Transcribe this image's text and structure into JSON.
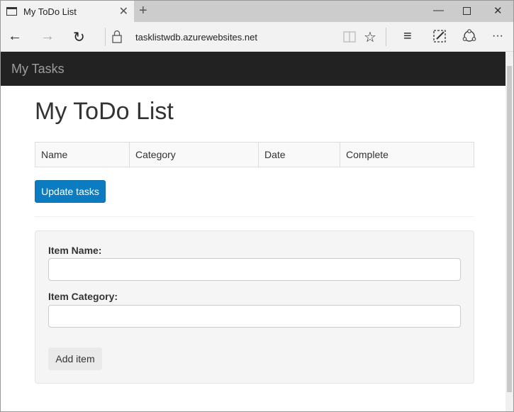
{
  "browser": {
    "tab_title": "My ToDo List",
    "url": "tasklistwdb.azurewebsites.net"
  },
  "navbar": {
    "brand": "My Tasks"
  },
  "page": {
    "title": "My ToDo List",
    "table": {
      "headers": [
        "Name",
        "Category",
        "Date",
        "Complete"
      ]
    },
    "update_button": "Update tasks",
    "form": {
      "name_label": "Item Name:",
      "name_value": "",
      "category_label": "Item Category:",
      "category_value": "",
      "add_button": "Add item"
    }
  },
  "colors": {
    "navbar": "#222222",
    "primary_button": "#0c7cc2",
    "well": "#f5f5f5"
  }
}
